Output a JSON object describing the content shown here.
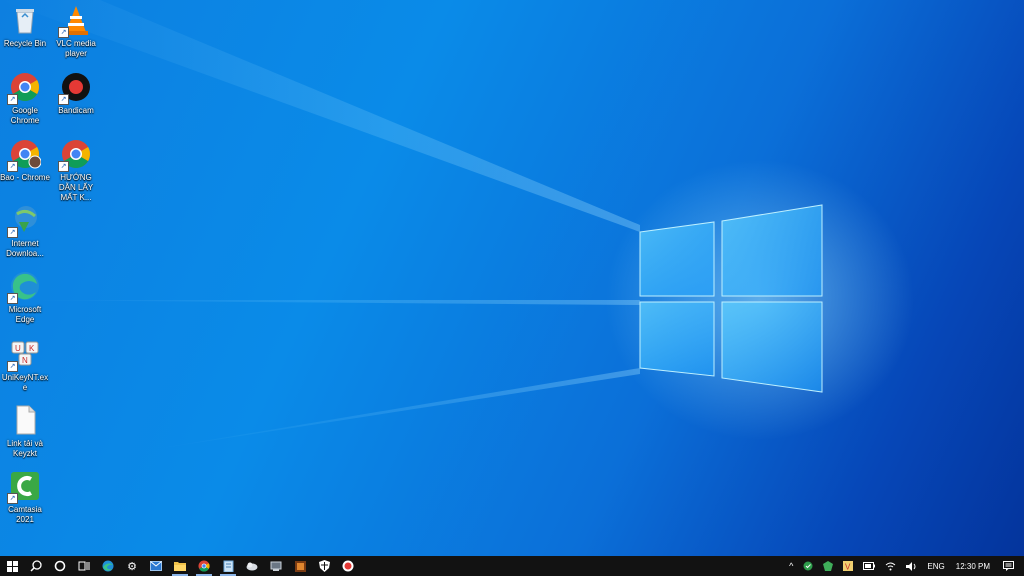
{
  "desktop": {
    "icons": [
      {
        "id": "recycle-bin",
        "label": "Recycle Bin"
      },
      {
        "id": "vlc",
        "label": "VLC media player"
      },
      {
        "id": "google-chrome",
        "label": "Google Chrome"
      },
      {
        "id": "bandicam",
        "label": "Bandicam"
      },
      {
        "id": "bao-chrome",
        "label": "Bao - Chrome"
      },
      {
        "id": "huong-dan",
        "label": "HƯỚNG DẪN LẤY MẤT K..."
      },
      {
        "id": "idm",
        "label": "Internet Downloa..."
      },
      {
        "id": "edge",
        "label": "Microsoft Edge"
      },
      {
        "id": "unikey",
        "label": "UniKeyNT.exe"
      },
      {
        "id": "link-tai",
        "label": "Link tải và Keyzkt"
      },
      {
        "id": "camtasia",
        "label": "Camtasia 2021"
      }
    ]
  },
  "taskbar": {
    "apps": [
      "start",
      "search",
      "cortana",
      "task-view",
      "edge",
      "settings",
      "mail",
      "file-explorer",
      "chrome",
      "notepad",
      "app1",
      "app2",
      "app3",
      "app4",
      "bandicam"
    ]
  },
  "tray": {
    "language": "ENG",
    "time": "12:30 PM"
  }
}
